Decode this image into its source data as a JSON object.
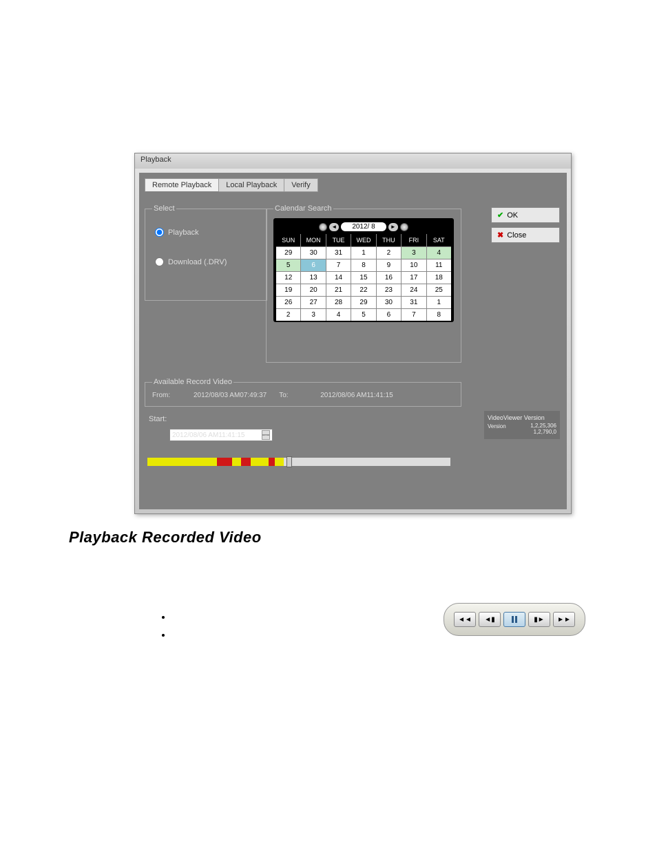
{
  "dialog": {
    "title": "Playback",
    "tabs": [
      "Remote Playback",
      "Local Playback",
      "Verify"
    ],
    "active_tab": 0
  },
  "select": {
    "legend": "Select",
    "options": [
      {
        "label": "Playback",
        "checked": true
      },
      {
        "label": "Download (.DRV)",
        "checked": false
      }
    ]
  },
  "calendar": {
    "legend": "Calendar Search",
    "year_month": "2012/ 8",
    "day_headers": [
      "SUN",
      "MON",
      "TUE",
      "WED",
      "THU",
      "FRI",
      "SAT"
    ],
    "weeks": [
      [
        {
          "d": "29"
        },
        {
          "d": "30"
        },
        {
          "d": "31"
        },
        {
          "d": "1"
        },
        {
          "d": "2"
        },
        {
          "d": "3",
          "a": 1
        },
        {
          "d": "4",
          "a": 1
        }
      ],
      [
        {
          "d": "5",
          "a": 1
        },
        {
          "d": "6",
          "s": 1
        },
        {
          "d": "7"
        },
        {
          "d": "8"
        },
        {
          "d": "9"
        },
        {
          "d": "10"
        },
        {
          "d": "11"
        }
      ],
      [
        {
          "d": "12"
        },
        {
          "d": "13"
        },
        {
          "d": "14"
        },
        {
          "d": "15"
        },
        {
          "d": "16"
        },
        {
          "d": "17"
        },
        {
          "d": "18"
        }
      ],
      [
        {
          "d": "19"
        },
        {
          "d": "20"
        },
        {
          "d": "21"
        },
        {
          "d": "22"
        },
        {
          "d": "23"
        },
        {
          "d": "24"
        },
        {
          "d": "25"
        }
      ],
      [
        {
          "d": "26"
        },
        {
          "d": "27"
        },
        {
          "d": "28"
        },
        {
          "d": "29"
        },
        {
          "d": "30"
        },
        {
          "d": "31"
        },
        {
          "d": "1"
        }
      ],
      [
        {
          "d": "2"
        },
        {
          "d": "3"
        },
        {
          "d": "4"
        },
        {
          "d": "5"
        },
        {
          "d": "6"
        },
        {
          "d": "7"
        },
        {
          "d": "8"
        }
      ]
    ]
  },
  "available": {
    "legend": "Available Record Video",
    "from_label": "From:",
    "from_value": "2012/08/03 AM07:49:37",
    "to_label": "To:",
    "to_value": "2012/08/06 AM11:41:15"
  },
  "start": {
    "label": "Start:",
    "value": "2012/08/06 AM11:41:15"
  },
  "buttons": {
    "ok": "OK",
    "close": "Close"
  },
  "version": {
    "title": "VideoViewer Version",
    "label": "Version",
    "values": [
      "1,2,25,306",
      "1,2,790,0"
    ]
  },
  "heading": "Playback Recorded Video",
  "icons": {
    "rewind": "rewind-icon",
    "step_back": "step-back-icon",
    "pause": "pause-icon",
    "step_fwd": "step-forward-icon",
    "fast_fwd": "fast-forward-icon"
  }
}
